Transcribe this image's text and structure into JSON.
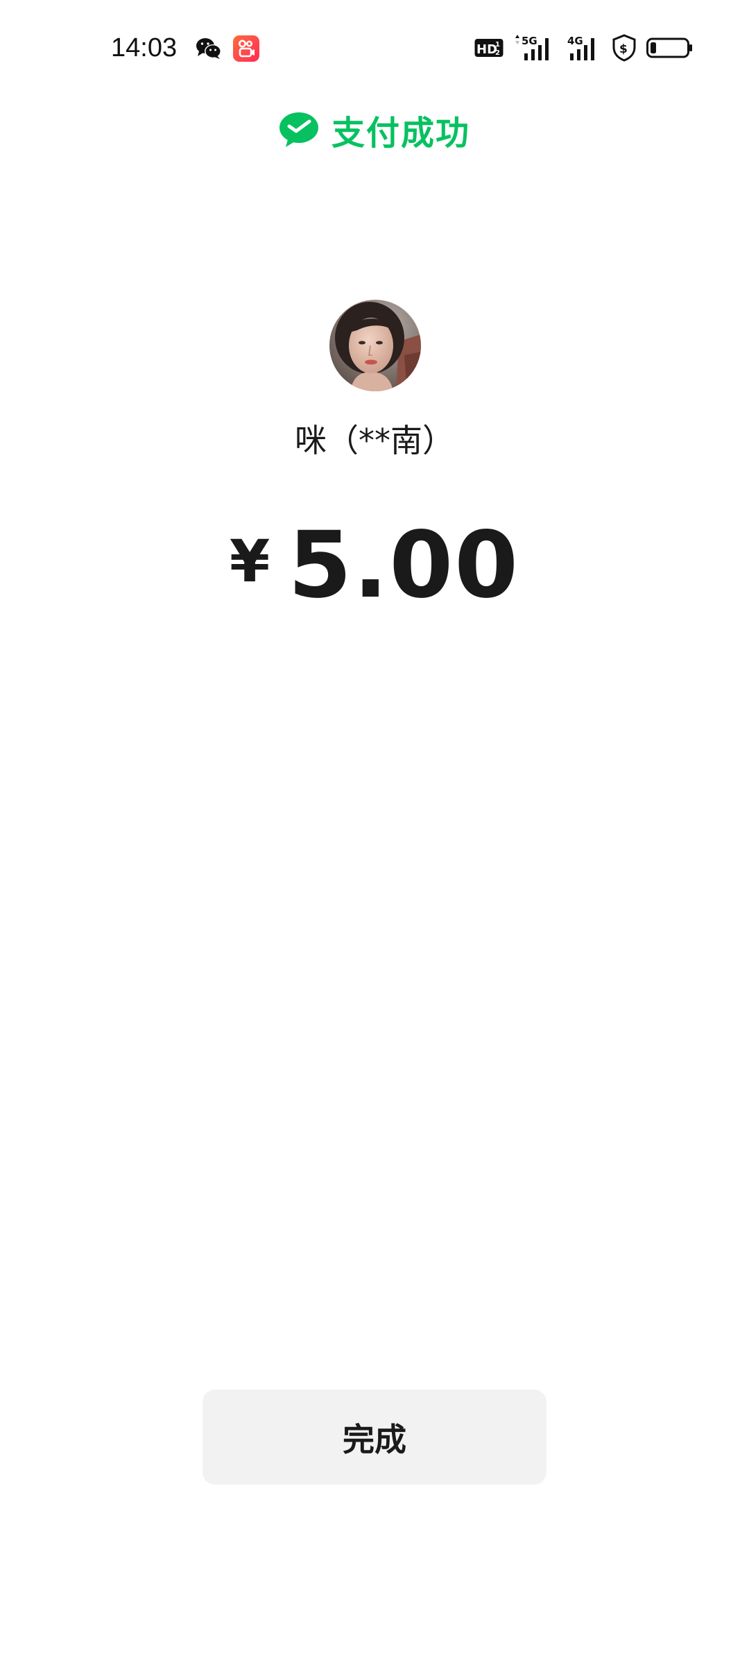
{
  "status_bar": {
    "time": "14:03",
    "left_icons": [
      "wechat-icon",
      "kuaishou-icon"
    ],
    "right_icons": [
      "hd-icon",
      "signal-5g-icon",
      "signal-4g-icon",
      "shield-dollar-icon",
      "battery-icon"
    ],
    "network_labels": {
      "hd": "HD",
      "hd_sub_1": "1",
      "hd_sub_2": "2",
      "fiveg": "5G",
      "fourg": "4G"
    },
    "battery_level": 0.15
  },
  "header": {
    "title": "支付成功",
    "icon": "wechat-pay-check-icon",
    "accent_color": "#07c160"
  },
  "payee": {
    "avatar": "avatar",
    "name": "咪（**南）"
  },
  "amount": {
    "currency": "¥",
    "value": "5.00"
  },
  "actions": {
    "done_label": "完成"
  }
}
